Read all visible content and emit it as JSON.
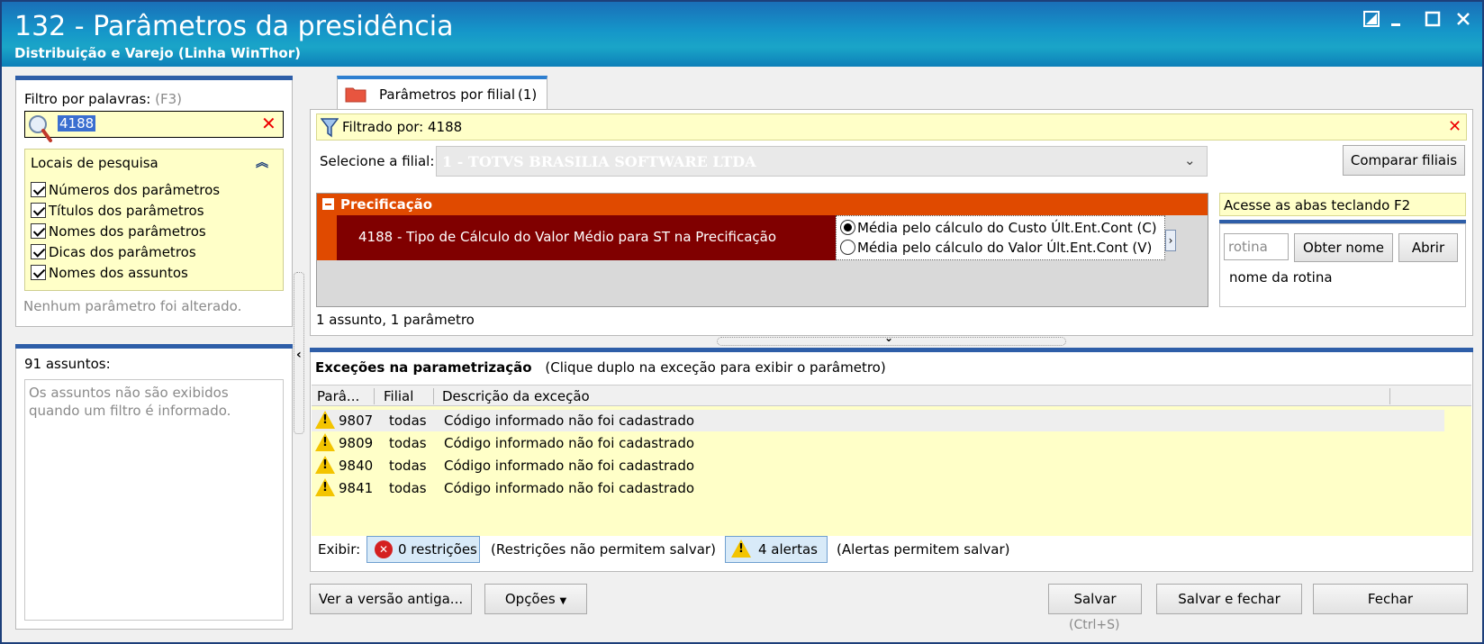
{
  "window": {
    "title": "132 - Parâmetros da presidência",
    "subtitle": "Distribuição e Varejo (Linha WinThor)",
    "controls": [
      "restore-icon",
      "minimize-icon",
      "maximize-icon",
      "close-icon"
    ]
  },
  "left": {
    "filter_label": "Filtro por palavras:",
    "filter_shortcut": "(F3)",
    "filter_value": "4188",
    "locations_title": "Locais de pesquisa",
    "locations": [
      "Números dos parâmetros",
      "Títulos dos parâmetros",
      "Nomes dos parâmetros",
      "Dicas dos parâmetros",
      "Nomes dos assuntos"
    ],
    "no_changes": "Nenhum parâmetro foi alterado.",
    "subjects_count": "91 assuntos:",
    "subjects_msg": "Os assuntos não são exibidos quando um filtro é informado."
  },
  "tab": {
    "label": "Parâmetros por filial",
    "count": "(1)"
  },
  "filter_bar": {
    "text": "Filtrado por: 4188"
  },
  "branch": {
    "label": "Selecione a filial:",
    "value": "1 - TOTVS BRASILIA SOFTWARE LTDA",
    "compare_button": "Comparar filiais"
  },
  "params": {
    "group": "Precificação",
    "item_title": "4188 - Tipo de Cálculo do Valor Médio para ST na Precificação",
    "options": [
      "Média pelo cálculo do Custo Últ.Ent.Cont (C)",
      "Média pelo cálculo do Valor Últ.Ent.Cont (V)"
    ],
    "selected_option": 0,
    "summary": "1 assunto, 1 parâmetro"
  },
  "right_panel": {
    "hint": "Acesse as abas teclando F2",
    "routine_placeholder": "rotina",
    "get_name_button": "Obter nome",
    "open_button": "Abrir",
    "routine_name": "nome da rotina"
  },
  "exceptions": {
    "title": "Exceções na parametrização",
    "subtitle": "(Clique duplo na exceção para exibir o parâmetro)",
    "columns": [
      "Parâ...",
      "Filial",
      "Descrição da exceção"
    ],
    "rows": [
      {
        "param": "9807",
        "branch": "todas",
        "desc": "Código informado não foi cadastrado"
      },
      {
        "param": "9809",
        "branch": "todas",
        "desc": "Código informado não foi cadastrado"
      },
      {
        "param": "9840",
        "branch": "todas",
        "desc": "Código informado não foi cadastrado"
      },
      {
        "param": "9841",
        "branch": "todas",
        "desc": "Código informado não foi cadastrado"
      }
    ],
    "show_label": "Exibir:",
    "restrictions_button": "0 restrições",
    "restrictions_note": "(Restrições não permitem salvar)",
    "alerts_button": "4 alertas",
    "alerts_note": "(Alertas permitem salvar)"
  },
  "footer": {
    "old_version_button": "Ver a versão antiga...",
    "options_button": "Opções",
    "save_button": "Salvar",
    "save_shortcut": "(Ctrl+S)",
    "save_close_button": "Salvar e fechar",
    "close_button": "Fechar"
  }
}
